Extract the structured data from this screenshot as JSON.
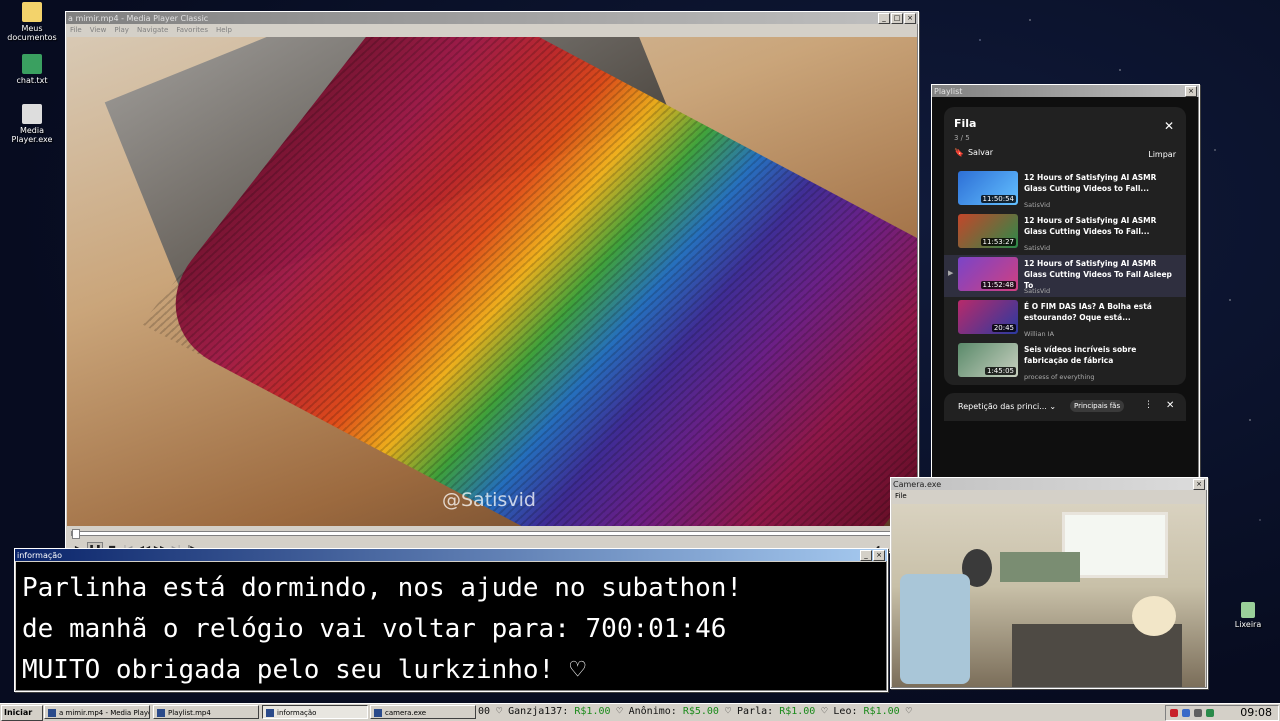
{
  "desktop": {
    "icons": [
      {
        "label": "Meus documentos",
        "color": "#f3d36b"
      },
      {
        "label": "chat.txt",
        "color": "#3aa060"
      },
      {
        "label": "Media Player.exe",
        "color": "#dddddd"
      }
    ],
    "recycle_label": "Lixeira"
  },
  "player": {
    "title": "a mimir.mp4 - Media Player Classic",
    "menu": [
      "File",
      "View",
      "Play",
      "Navigate",
      "Favorites",
      "Help"
    ],
    "watermark": "@Satisvid",
    "progress_fraction": 0.0
  },
  "playlist_window": {
    "title": "Playlist",
    "heading": "Fila",
    "count": "3 / 5",
    "save_label": "Salvar",
    "clear_label": "Limpar",
    "items": [
      {
        "title": "12 Hours of Satisfying AI ASMR Glass Cutting Videos to Fall...",
        "channel": "SatisVid",
        "duration": "11:50:54",
        "current": false,
        "thumb": "#2d6fd6"
      },
      {
        "title": "12 Hours of Satisfying AI ASMR Glass Cutting Videos To Fall...",
        "channel": "SatisVid",
        "duration": "11:53:27",
        "current": false,
        "thumb": "#c4462a"
      },
      {
        "title": "12 Hours of Satisfying AI ASMR Glass Cutting Videos To Fall Asleep To",
        "channel": "SatisVid",
        "duration": "11:52:48",
        "current": true,
        "thumb": "#7a44c8"
      },
      {
        "title": "É O FIM DAS IAs? A Bolha está estourando? Oque está...",
        "channel": "Willian IA",
        "duration": "20:45",
        "current": false,
        "thumb": "#b82a6a"
      },
      {
        "title": "Seis vídeos incríveis sobre fabricação de fábrica",
        "channel": "process of everything",
        "duration": "1:45:05",
        "current": false,
        "thumb": "#5a8a6a"
      }
    ],
    "repeat_label": "Repetição das princi...",
    "chip_label": "Principais fãs"
  },
  "info_window": {
    "title": "informação",
    "lines": [
      "Parlinha está dormindo, nos ajude no subathon!",
      "de manhã o relógio vai voltar para:  700:01:46",
      "MUITO obrigada pelo seu lurkzinho! ♡"
    ]
  },
  "camera_window": {
    "title": "Camera.exe",
    "menu": [
      "File"
    ]
  },
  "taskbar": {
    "start_label": "Iniciar",
    "tasks": [
      {
        "label": "a mimir.mp4 - Media Playe...",
        "active": false
      },
      {
        "label": "Playlist.mp4",
        "active": false
      },
      {
        "label": "informação",
        "active": true
      },
      {
        "label": "camera.exe",
        "active": false
      }
    ],
    "ticker": [
      {
        "name": "00",
        "amount": ""
      },
      {
        "name": "Ganzja137:",
        "amount": "R$1.00"
      },
      {
        "name": "Anônimo:",
        "amount": "R$5.00"
      },
      {
        "name": "Parla:",
        "amount": "R$1.00"
      },
      {
        "name": "Leo:",
        "amount": "R$1.00"
      }
    ],
    "clock": "09:08"
  }
}
